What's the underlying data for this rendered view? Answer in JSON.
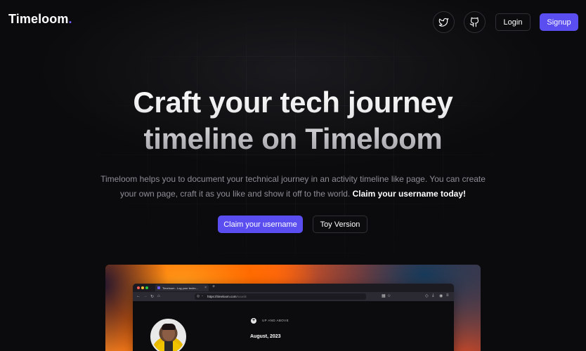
{
  "header": {
    "logo_text": "Timeloom",
    "logo_dot": ".",
    "twitter_icon": "twitter-icon",
    "github_icon": "github-icon",
    "login_label": "Login",
    "signup_label": "Signup"
  },
  "hero": {
    "title_line1": "Craft your tech journey",
    "title_line2": "timeline on Timeloom",
    "subtitle": "Timeloom helps you to document your technical journey in an activity timeline like page. You can create your own page, craft it as you like and show it off to the world.",
    "subtitle_strong": "Claim your username today!",
    "claim_label": "Claim your username",
    "toy_label": "Toy Version"
  },
  "preview": {
    "tab_title": "Timeloom - Log your techn...",
    "tab_close": "×",
    "new_tab": "+",
    "url_domain": "https://timeloom.com",
    "url_path": "/sounik",
    "timeline_marker": "+",
    "timeline_label": "UP AND ABOVE",
    "timeline_month": "August, 2023"
  },
  "colors": {
    "accent": "#5b4ef0",
    "background": "#0b0b0d",
    "border": "#2f2f35"
  }
}
